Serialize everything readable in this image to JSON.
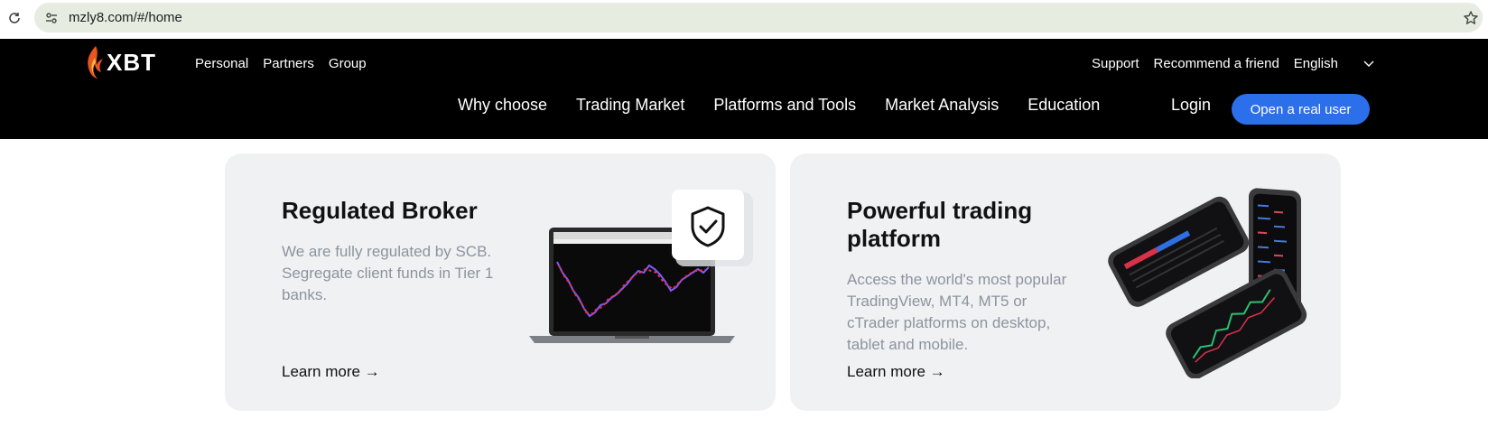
{
  "browser": {
    "url": "mzly8.com/#/home",
    "icons": [
      "reload-icon",
      "site-info-icon",
      "bookmark-star-icon"
    ]
  },
  "header": {
    "logo_text": "XBT",
    "top_nav": [
      "Personal",
      "Partners",
      "Group"
    ],
    "support": "Support",
    "recommend": "Recommend a friend",
    "language": "English",
    "main_nav": [
      "Why choose",
      "Trading Market",
      "Platforms and Tools",
      "Market Analysis",
      "Education"
    ],
    "login": "Login",
    "open_account": "Open a real user",
    "colors": {
      "header_bg": "#000000",
      "accent": "#2b6fea"
    }
  },
  "cards": [
    {
      "title": "Regulated Broker",
      "description": "We are fully regulated by SCB. Segregate client funds in Tier 1 banks.",
      "link": "Learn more →",
      "illustration": "laptop-chart-with-shield-icon"
    },
    {
      "title": "Powerful trading platform",
      "description": "Access the world's most popular TradingView, MT4, MT5 or cTrader platforms on desktop, tablet and mobile.",
      "link": "Learn more →",
      "illustration": "phones-trading-app"
    }
  ]
}
